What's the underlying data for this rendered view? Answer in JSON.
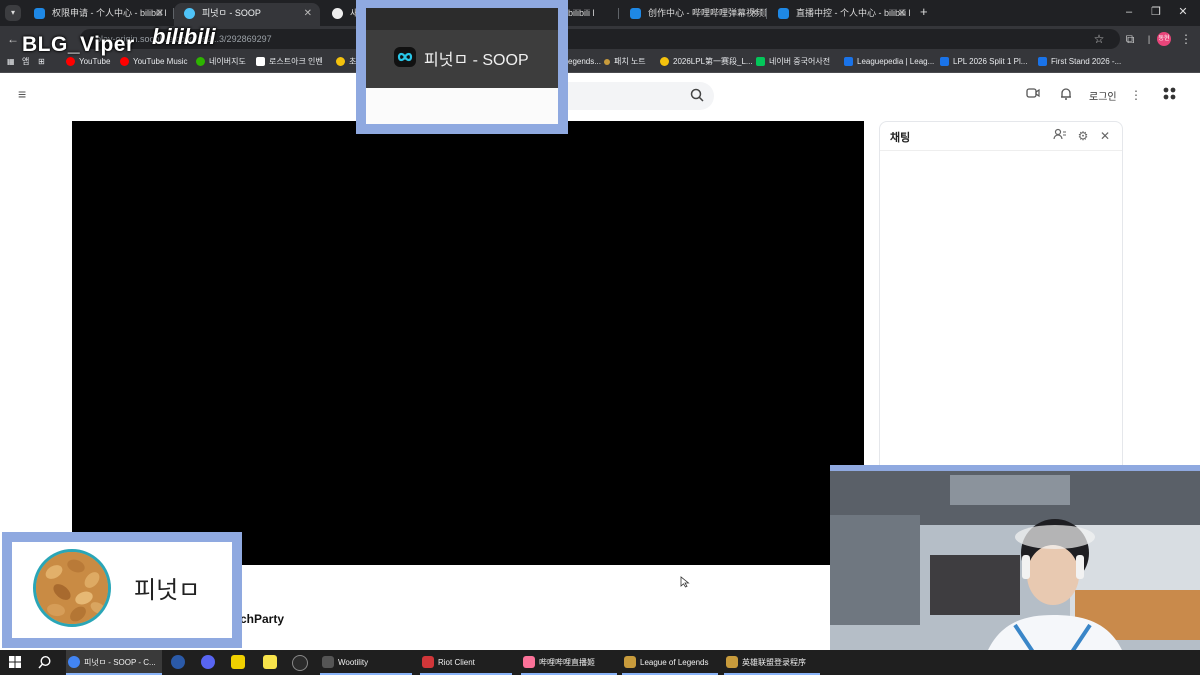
{
  "browser": {
    "tabs": [
      {
        "title": "权限申请 - 个人中心 - bilibili l",
        "color": "#1e88e5",
        "active": false
      },
      {
        "title": "피넛ㅁ - SOOP",
        "color": "#4fc3f7",
        "active": true
      },
      {
        "title": "새 탭",
        "color": "#eeeeee",
        "active": false
      },
      {
        "title": "bilibili l",
        "color": "#1e88e5",
        "active": false
      },
      {
        "title": "创作中心 - 哔哩哔哩弹幕视频网",
        "color": "#1e88e5",
        "active": false
      },
      {
        "title": "直播中控 - 个人中心 - bilibili l",
        "color": "#1e88e5",
        "active": false
      }
    ],
    "new_tab_label": "+",
    "url": "play-origin.sooplive.co.kr/ss2...3/292869297",
    "profile_initials": "동현",
    "window_controls": {
      "minimize": "–",
      "maximize": "❐",
      "close": "✕"
    }
  },
  "bookmarks": [
    {
      "label": "앱",
      "color": "#9aa0a6"
    },
    {
      "label": "YouTube",
      "color": "#ff0000"
    },
    {
      "label": "YouTube Music",
      "color": "#ff0000"
    },
    {
      "label": "네이버지도",
      "color": "#2db400"
    },
    {
      "label": "로스트아크 인벤",
      "color": "#ffffff"
    },
    {
      "label": "초",
      "color": "#f4c20d"
    },
    {
      "label": "egends...",
      "color": "#c89b3c"
    },
    {
      "label": "패치 노트",
      "color": "#c89b3c"
    },
    {
      "label": "2026LPL第一赛段_L...",
      "color": "#f4c20d"
    },
    {
      "label": "네이버 중국어사전",
      "color": "#03c75a"
    },
    {
      "label": "Leaguepedia | Leag...",
      "color": "#1a73e8"
    },
    {
      "label": "LPL 2026 Split 1 Pl...",
      "color": "#1a73e8"
    },
    {
      "label": "First Stand 2026 -...",
      "color": "#1a73e8"
    }
  ],
  "page": {
    "header": {
      "login_label": "로그인"
    },
    "chat": {
      "title": "채팅"
    },
    "stream_title_fragment": "chParty"
  },
  "overlays": {
    "watermark_user": "BLG_Viper",
    "watermark_site": "bilibili",
    "logo_text": "피넛ㅁ - SOOP",
    "profile_name": "피넛ㅁ"
  },
  "taskbar": {
    "apps": [
      {
        "label": "피넛ㅁ - SOOP - C...",
        "color": "#4285f4",
        "state": "active"
      },
      {
        "label": "Wootility",
        "color": "#555555",
        "state": "running"
      },
      {
        "label": "Riot Client",
        "color": "#d13639",
        "state": "running"
      },
      {
        "label": "哔哩哔哩直播姬",
        "color": "#fb7299",
        "state": "running"
      },
      {
        "label": "League of Legends",
        "color": "#c89b3c",
        "state": "running"
      },
      {
        "label": "英雄联盟登录程序",
        "color": "#c89b3c",
        "state": "running"
      }
    ]
  }
}
